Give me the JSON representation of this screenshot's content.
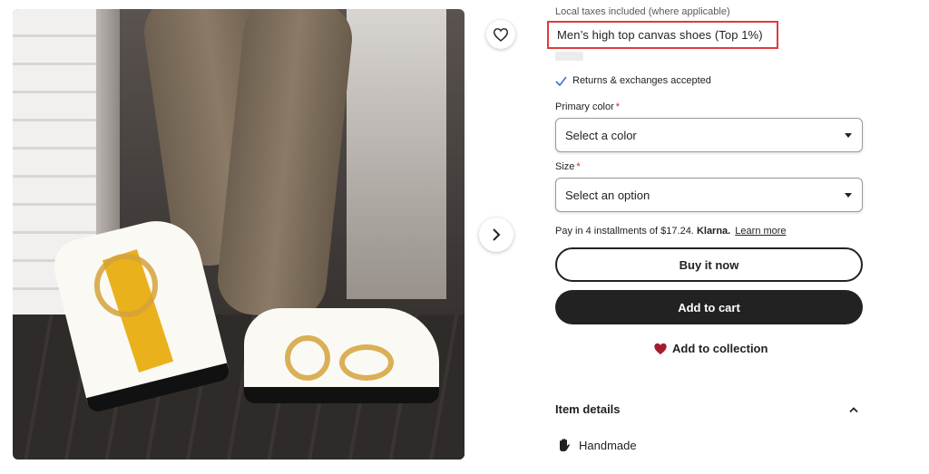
{
  "product": {
    "image_alt": "Men's high top canvas shoes",
    "tax_note": "Local taxes included (where applicable)",
    "title": "Men’s high top canvas shoes (Top 1%)"
  },
  "returns": {
    "label": "Returns & exchanges accepted"
  },
  "primary_color": {
    "label": "Primary color",
    "required_mark": "*",
    "placeholder": "Select a color"
  },
  "size": {
    "label": "Size",
    "required_mark": "*",
    "placeholder": "Select an option"
  },
  "installments": {
    "text": "Pay in 4 installments of $17.24.",
    "provider": "Klarna.",
    "link": "Learn more"
  },
  "actions": {
    "buy_now": "Buy it now",
    "add_to_cart": "Add to cart",
    "add_to_collection": "Add to collection"
  },
  "item_details": {
    "heading": "Item details",
    "handmade": "Handmade"
  },
  "icons": {
    "favorite": "heart-outline-icon",
    "next": "chevron-right-icon",
    "check": "checkmark-icon",
    "collection": "heart-filled-icon",
    "collapse": "chevron-up-icon",
    "handmade": "hand-icon"
  },
  "colors": {
    "accent_red": "#c7291d",
    "highlight_border": "#e03a3a",
    "button_dark": "#222222",
    "check_blue": "#3b6fd8",
    "heart_red": "#a61a2e"
  }
}
